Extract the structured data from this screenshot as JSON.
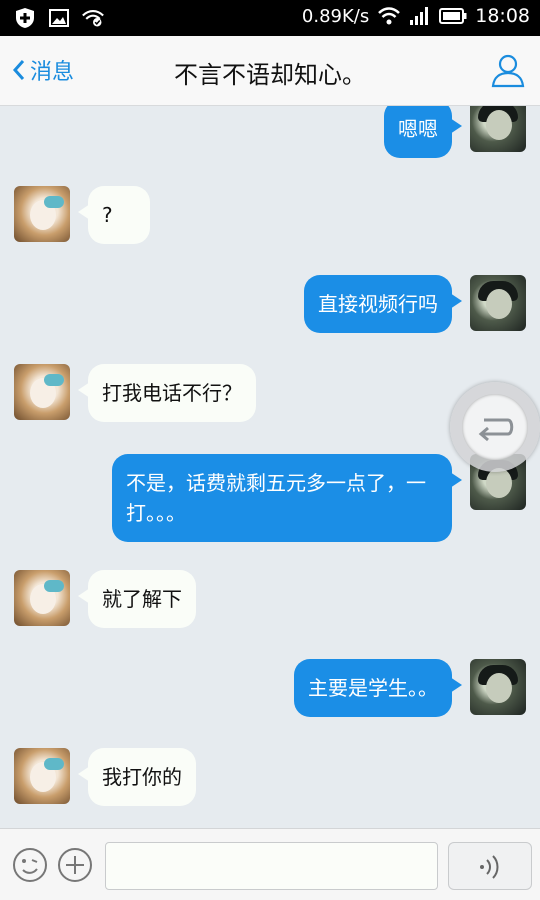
{
  "status_bar": {
    "speed": "0.89K/s",
    "time": "18:08",
    "icons": [
      "shield-icon",
      "image-icon",
      "wifi-check-icon",
      "wifi-icon",
      "signal-icon",
      "battery-icon"
    ]
  },
  "header": {
    "back_label": "消息",
    "title": "不言不语却知心。",
    "profile_icon": "person-icon",
    "accent_color": "#1a8cde"
  },
  "messages": [
    {
      "sender": "self",
      "text": "嗯嗯"
    },
    {
      "sender": "other",
      "text": "?"
    },
    {
      "sender": "self",
      "text": "直接视频行吗"
    },
    {
      "sender": "other",
      "text": "打我电话不行？"
    },
    {
      "sender": "self",
      "text": "不是，话费就剩五元多一点了，一打。。。"
    },
    {
      "sender": "other",
      "text": "就了解下"
    },
    {
      "sender": "self",
      "text": "主要是学生。。"
    },
    {
      "sender": "other",
      "text": "我打你的"
    }
  ],
  "input_bar": {
    "emoji_icon": "emoji-icon",
    "plus_icon": "plus-icon",
    "field_value": "",
    "voice_icon": "voice-icon"
  },
  "colors": {
    "self_bubble": "#1b8ee6",
    "other_bubble": "#fafdf8",
    "chat_background": "#e6ebef"
  }
}
